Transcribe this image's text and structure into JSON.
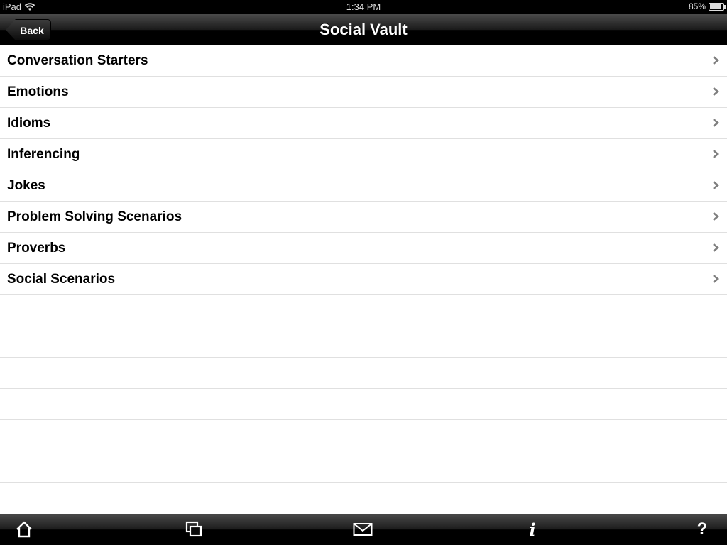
{
  "status_bar": {
    "carrier": "iPad",
    "time": "1:34 PM",
    "battery": "85%",
    "battery_level": 0.85
  },
  "nav": {
    "back_label": "Back",
    "title": "Social Vault"
  },
  "list": {
    "items": [
      {
        "label": "Conversation Starters"
      },
      {
        "label": "Emotions"
      },
      {
        "label": "Idioms"
      },
      {
        "label": "Inferencing"
      },
      {
        "label": "Jokes"
      },
      {
        "label": "Problem Solving Scenarios"
      },
      {
        "label": "Proverbs"
      },
      {
        "label": "Social Scenarios"
      }
    ]
  },
  "toolbar": {
    "items": [
      {
        "icon": "home-icon"
      },
      {
        "icon": "windows-icon"
      },
      {
        "icon": "mail-icon"
      },
      {
        "icon": "info-icon"
      },
      {
        "icon": "help-icon"
      }
    ],
    "info_glyph": "i",
    "help_glyph": "?"
  }
}
